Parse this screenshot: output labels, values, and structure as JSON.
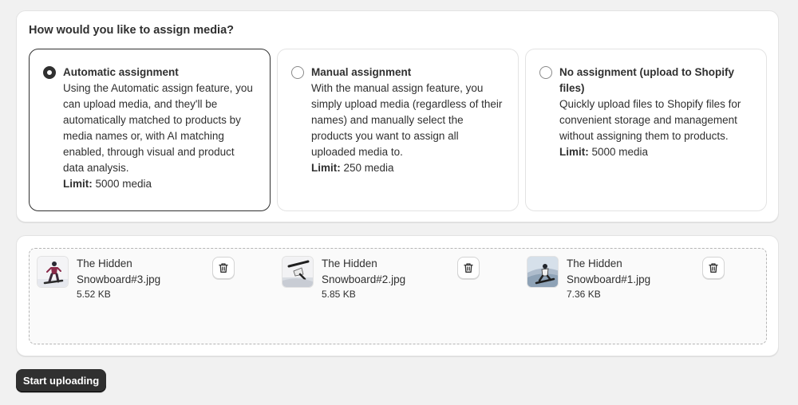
{
  "assign_section": {
    "title": "How would you like to assign media?",
    "options": [
      {
        "label": "Automatic assignment",
        "description": "Using the Automatic assign feature, you can upload media, and they'll be automatically matched to products by media names or, with AI matching enabled, through visual and product data analysis.",
        "limit_label": "Limit:",
        "limit_value": " 5000 media",
        "selected": true
      },
      {
        "label": "Manual assignment",
        "description": "With the manual assign feature, you simply upload media (regardless of their names) and manually select the products you want to assign all uploaded media to.",
        "limit_label": "Limit:",
        "limit_value": " 250 media",
        "selected": false
      },
      {
        "label": "No assignment (upload to Shopify files)",
        "description": "Quickly upload files to Shopify files for convenient storage and management without assigning them to products.",
        "limit_label": "Limit:",
        "limit_value": " 5000 media",
        "selected": false
      }
    ]
  },
  "files": [
    {
      "name": "The Hidden Snowboard#3.jpg",
      "size": "5.52 KB",
      "thumbnail_icon": "snowboarder-image"
    },
    {
      "name": "The Hidden Snowboard#2.jpg",
      "size": "5.85 KB",
      "thumbnail_icon": "snowboarder-image"
    },
    {
      "name": "The Hidden Snowboard#1.jpg",
      "size": "7.36 KB",
      "thumbnail_icon": "snowboarder-image"
    }
  ],
  "actions": {
    "start_label": "Start uploading"
  },
  "colors": {
    "background": "#f1f1f1",
    "card": "#ffffff",
    "primary_button": "#303030",
    "selected_border": "#303030",
    "dropzone_border": "#b5b5b5"
  }
}
